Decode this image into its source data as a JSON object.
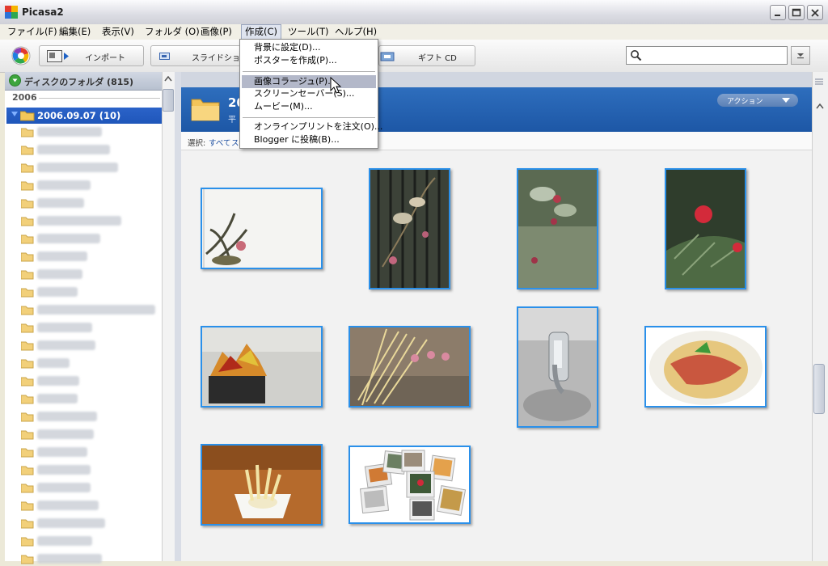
{
  "window": {
    "title": "Picasa2"
  },
  "menubar": {
    "items": [
      "ファイル(F)",
      "編集(E)",
      "表示(V)",
      "フォルダ (O)",
      "画像(P)",
      "作成(C)",
      "ツール(T)",
      "ヘルプ(H)"
    ],
    "active_index": 5
  },
  "toolbar": {
    "import_label": "インポート",
    "slideshow_label": "スライドショー",
    "gift_cd_label": "ギフト CD",
    "search_placeholder": ""
  },
  "create_menu": {
    "items": [
      "背景に設定(D)...",
      "ポスターを作成(P)...",
      "画像コラージュ(P)...",
      "スクリーンセーバー(S)...",
      "ムービー(M)...",
      "オンラインプリントを注文(O)...",
      "Blogger に投稿(B)..."
    ],
    "highlighted_index": 2
  },
  "left_panel": {
    "header": "ディスクのフォルダ (815)",
    "year": "2006",
    "selected_folder": "2006.09.07 (10)"
  },
  "folder_view": {
    "date": "20",
    "subtitle": "平",
    "action_label": "アクション",
    "select_label": "選択:",
    "select_all": "すべて",
    "select_more": "ス"
  },
  "colors": {
    "selection_blue": "#1f56ba",
    "thumb_border": "#2a90ea",
    "folder_header": "#2e6ebd"
  }
}
